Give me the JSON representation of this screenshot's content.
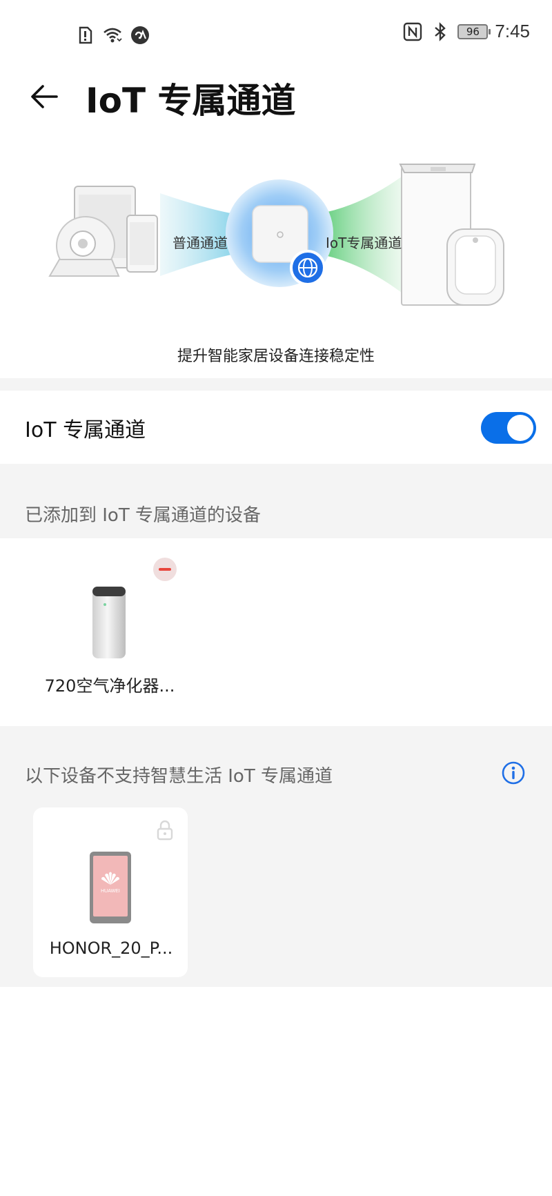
{
  "status_bar": {
    "battery": "96",
    "time": "7:45",
    "icons": [
      "sim-alert-icon",
      "wifi-icon",
      "app-badge-icon",
      "nfc-icon",
      "bluetooth-icon",
      "battery-icon"
    ]
  },
  "header": {
    "title": "IoT 专属通道",
    "back_icon": "back-arrow-icon"
  },
  "illustration": {
    "left_label": "普通通道",
    "right_label": "IoT专属通道"
  },
  "subtitle": "提升智能家居设备连接稳定性",
  "toggle": {
    "label": "IoT 专属通道",
    "enabled": true
  },
  "added_section": {
    "title": "已添加到 IoT 专属通道的设备",
    "devices": [
      {
        "name": "720空气净化器..."
      }
    ]
  },
  "unsupported_section": {
    "title": "以下设备不支持智慧生活 IoT 专属通道",
    "devices": [
      {
        "name": "HONOR_20_P...",
        "screen_logo": "HUAWEI"
      }
    ]
  },
  "colors": {
    "accent": "#0a6fe8",
    "remove": "#e8453c",
    "section_bg": "#f4f4f4"
  }
}
